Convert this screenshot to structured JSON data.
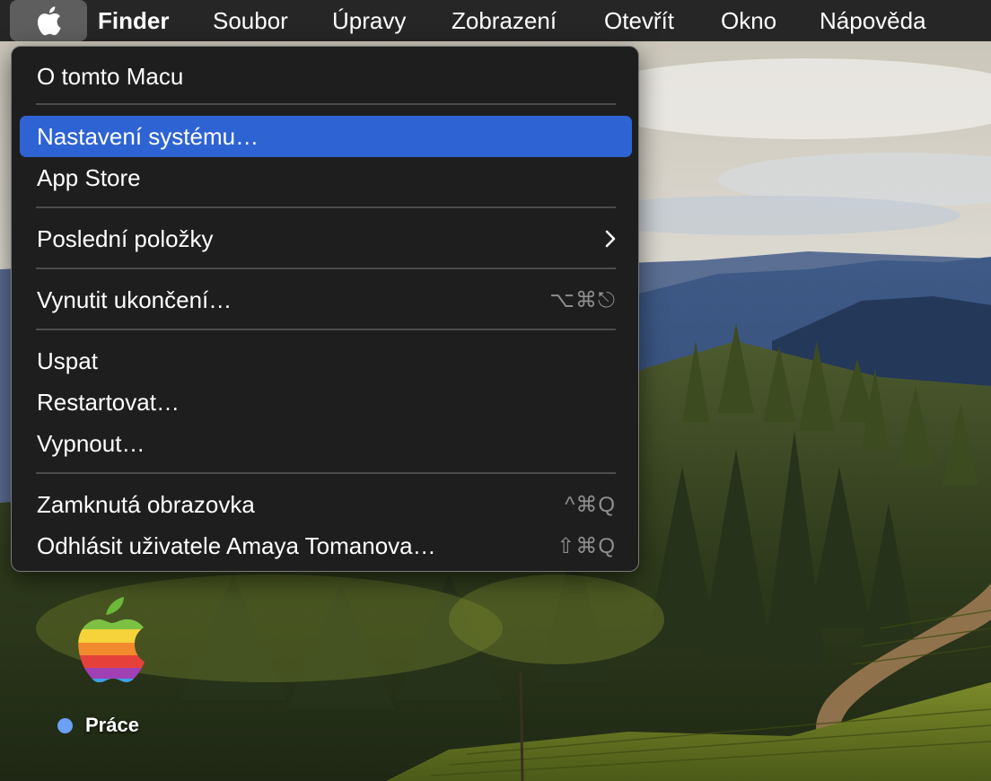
{
  "menubar": {
    "apple_icon": "apple-logo-icon",
    "items": [
      "Finder",
      "Soubor",
      "Úpravy",
      "Zobrazení",
      "Otevřít",
      "Okno",
      "Nápověda"
    ]
  },
  "apple_menu": {
    "items": [
      {
        "label": "O tomto Macu",
        "shortcut": ""
      },
      {
        "label": "Nastavení systému…",
        "shortcut": "",
        "selected": true
      },
      {
        "label": "App Store",
        "shortcut": ""
      },
      {
        "label": "Poslední položky",
        "submenu": true
      },
      {
        "label": "Vynutit ukončení…",
        "shortcut": "⌥⌘⎋"
      },
      {
        "label": "Uspat",
        "shortcut": ""
      },
      {
        "label": "Restartovat…",
        "shortcut": ""
      },
      {
        "label": "Vypnout…",
        "shortcut": ""
      },
      {
        "label": "Zamknutá obrazovka",
        "shortcut": "^⌘Q"
      },
      {
        "label": "Odhlásit uživatele Amaya Tomanova…",
        "shortcut": "⇧⌘Q"
      }
    ],
    "submenu_icon": "chevron-right-icon"
  },
  "desktop": {
    "icon_label": "Práce",
    "icon_name": "rainbow-apple-folder-icon",
    "tag_color": "#6aa0f5"
  },
  "colors": {
    "menubar_bg": "#262626",
    "menu_bg": "#1e1e1e",
    "selection": "#2e63d3"
  }
}
